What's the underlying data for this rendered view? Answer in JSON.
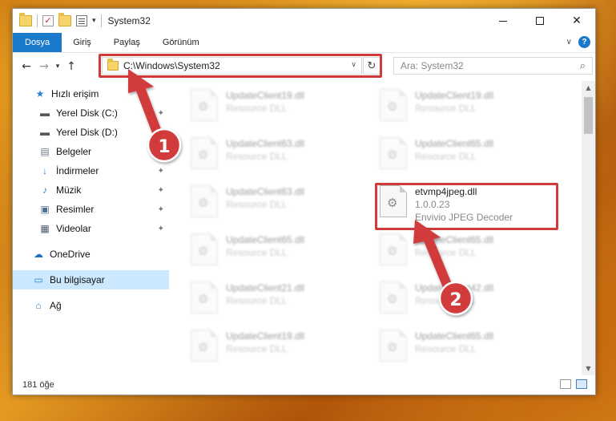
{
  "window": {
    "title": "System32"
  },
  "ribbon": {
    "tabs": [
      "Dosya",
      "Giriş",
      "Paylaş",
      "Görünüm"
    ]
  },
  "address": {
    "path": "C:\\Windows\\System32",
    "search_placeholder": "Ara: System32"
  },
  "nav": {
    "items": [
      {
        "label": "Hızlı erişim",
        "icon": "star-icon"
      },
      {
        "label": "Yerel Disk (C:)",
        "icon": "drive-icon"
      },
      {
        "label": "Yerel Disk (D:)",
        "icon": "drive-icon"
      },
      {
        "label": "Belgeler",
        "icon": "documents-icon"
      },
      {
        "label": "İndirmeler",
        "icon": "download-icon"
      },
      {
        "label": "Müzik",
        "icon": "music-icon"
      },
      {
        "label": "Resimler",
        "icon": "pictures-icon"
      },
      {
        "label": "Videolar",
        "icon": "videos-icon"
      },
      {
        "label": "OneDrive",
        "icon": "cloud-icon"
      },
      {
        "label": "Bu bilgisayar",
        "icon": "computer-icon"
      },
      {
        "label": "Ağ",
        "icon": "network-icon"
      }
    ]
  },
  "files": {
    "left": [
      {
        "name": "UpdateClient19.dll",
        "desc": "Resource DLL"
      },
      {
        "name": "UpdateClient63.dll",
        "desc": "Resource DLL"
      },
      {
        "name": "UpdateClient63.dll",
        "desc": "Resource DLL"
      },
      {
        "name": "UpdateClient65.dll",
        "desc": "Resource DLL"
      },
      {
        "name": "UpdateClient21.dll",
        "desc": "Resource DLL"
      },
      {
        "name": "UpdateClient19.dll",
        "desc": "Resource DLL"
      }
    ],
    "right": [
      {
        "name": "UpdateClient19.dll",
        "desc": "Resource DLL"
      },
      {
        "name": "UpdateClient65.dll",
        "desc": "Resource DLL"
      },
      {
        "name": "UpdateClient65.dll",
        "desc": "Resource DLL"
      },
      {
        "name": "UpdateClient42.dll",
        "desc": "Resource DLL"
      },
      {
        "name": "UpdateClient65.dll",
        "desc": "Resource DLL"
      }
    ],
    "target": {
      "name": "etvmp4jpeg.dll",
      "version": "1.0.0.23",
      "desc": "Envivio JPEG Decoder"
    }
  },
  "status": {
    "count": "181 öğe"
  },
  "annotations": {
    "step1": "1",
    "step2": "2",
    "color": "#d23a3a"
  }
}
